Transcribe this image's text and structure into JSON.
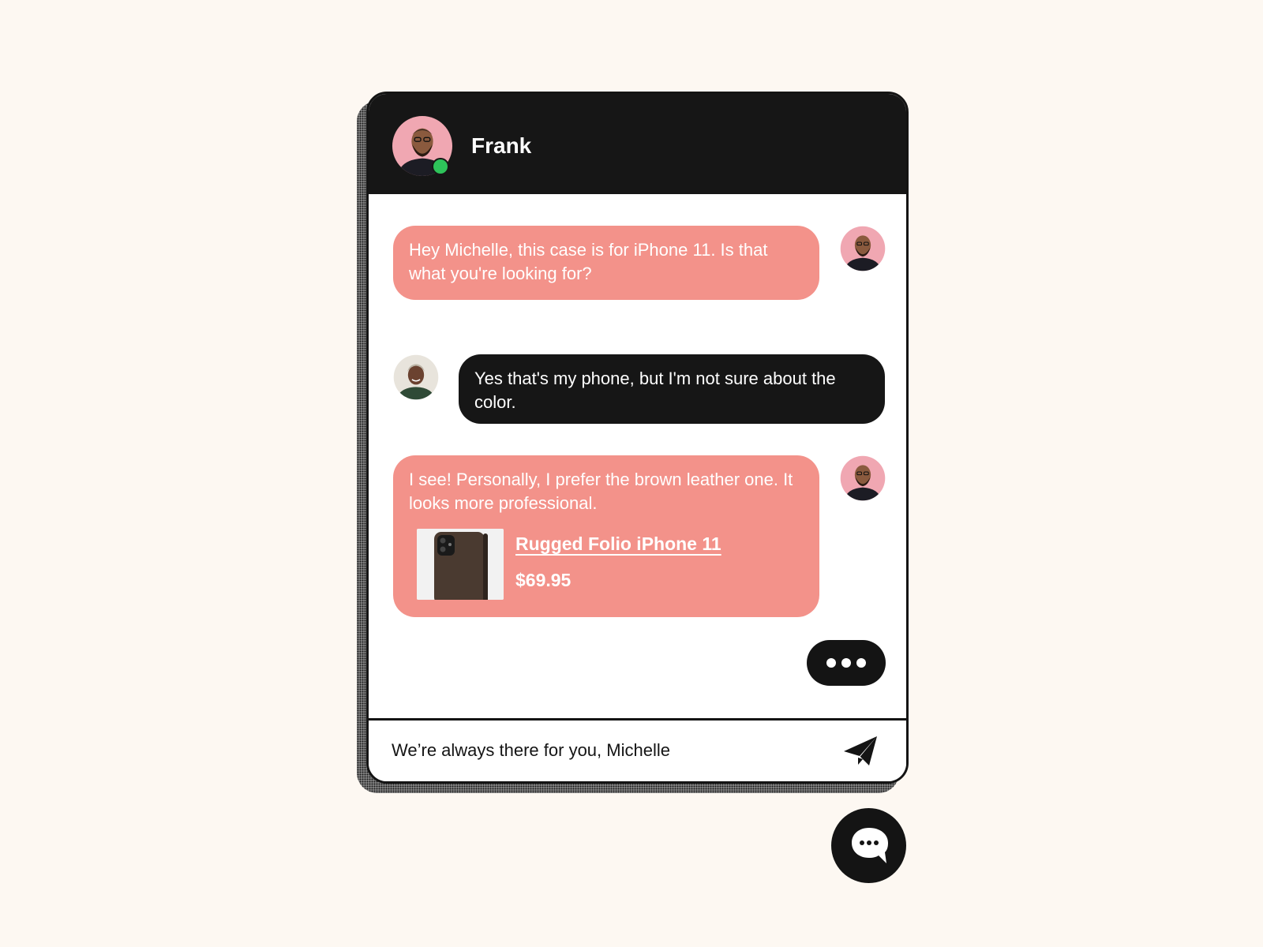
{
  "colors": {
    "background": "#fdf8f2",
    "header": "#161616",
    "agent_bubble": "#f3928a",
    "user_bubble": "#161616",
    "online_status": "#2ec35a"
  },
  "header": {
    "agent_name": "Frank",
    "status": "online"
  },
  "messages": [
    {
      "sender": "agent",
      "text": "Hey Michelle, this case is for iPhone 11. Is that what you're looking for?"
    },
    {
      "sender": "user",
      "text": "Yes that's my phone, but I'm not sure about the color."
    },
    {
      "sender": "agent",
      "text": "I see! Personally, I prefer the brown leather one. It looks more professional.",
      "product": {
        "name": "Rugged Folio iPhone 11",
        "price": "$69.95"
      }
    }
  ],
  "composer": {
    "placeholder": "We’re always there for you, Michelle"
  },
  "icons": {
    "send": "paper-plane-icon",
    "launcher": "chat-bubble-icon",
    "typing": "typing-dots-icon"
  }
}
